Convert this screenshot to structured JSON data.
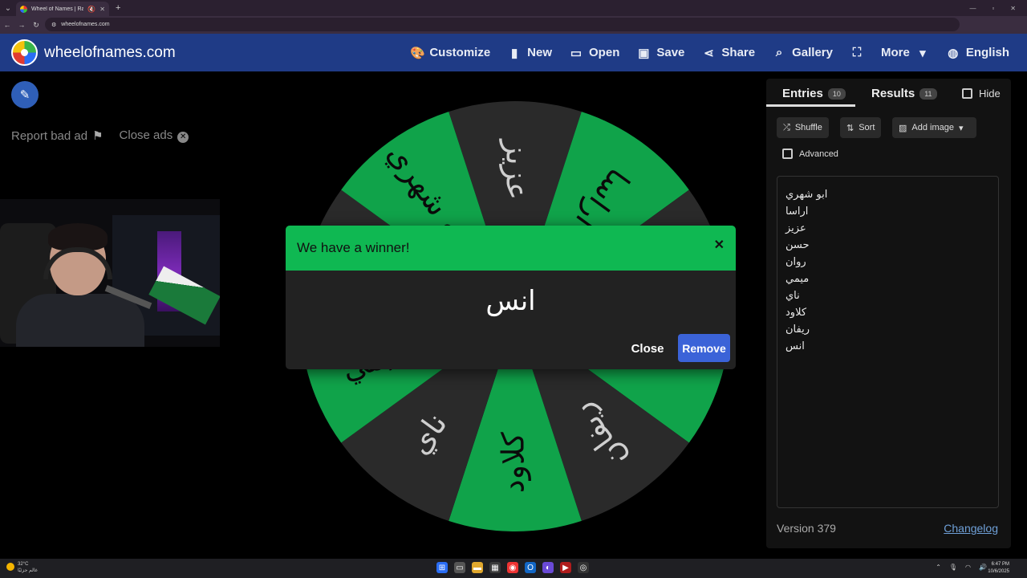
{
  "browser": {
    "tab_title": "Wheel of Names | Random",
    "url": "wheelofnames.com"
  },
  "header": {
    "site_title": "wheelofnames.com",
    "menu": [
      {
        "label": "Customize",
        "icon": "palette-icon"
      },
      {
        "label": "New",
        "icon": "file-icon"
      },
      {
        "label": "Open",
        "icon": "folder-icon"
      },
      {
        "label": "Save",
        "icon": "save-icon"
      },
      {
        "label": "Share",
        "icon": "share-icon"
      },
      {
        "label": "Gallery",
        "icon": "search-icon"
      },
      {
        "label": "",
        "icon": "fullscreen-icon"
      },
      {
        "label": "More",
        "icon": "chevron-down-icon"
      },
      {
        "label": "English",
        "icon": "globe-icon"
      }
    ]
  },
  "ads": {
    "report": "Report bad ad",
    "close": "Close ads"
  },
  "wheel": {
    "segment_labels": [
      "عزيز",
      "اراسا",
      "حسن",
      "انس",
      "ريفان",
      "كلاود",
      "ناي",
      "ميمي",
      "روان",
      "ابو شهري"
    ],
    "colors": {
      "green": "#10a34a",
      "dark": "#2a2a2a"
    }
  },
  "modal": {
    "title": "We have a winner!",
    "winner": "انس",
    "close_label": "Close",
    "remove_label": "Remove"
  },
  "panel": {
    "tab_entries": "Entries",
    "entries_count": "10",
    "tab_results": "Results",
    "results_count": "11",
    "hide_label": "Hide",
    "shuffle": "Shuffle",
    "sort": "Sort",
    "add_image": "Add image",
    "advanced": "Advanced",
    "entries": [
      "ابو شهري",
      "اراسا",
      "عزيز",
      "حسن",
      "روان",
      "ميمي",
      "ناي",
      "كلاود",
      "ريفان",
      "انس"
    ],
    "version": "Version 379",
    "changelog": "Changelog"
  },
  "taskbar": {
    "temp": "32°C",
    "weather_text": "غالم جزئيًا",
    "time": "6:47 PM",
    "date": "10/6/2025"
  }
}
